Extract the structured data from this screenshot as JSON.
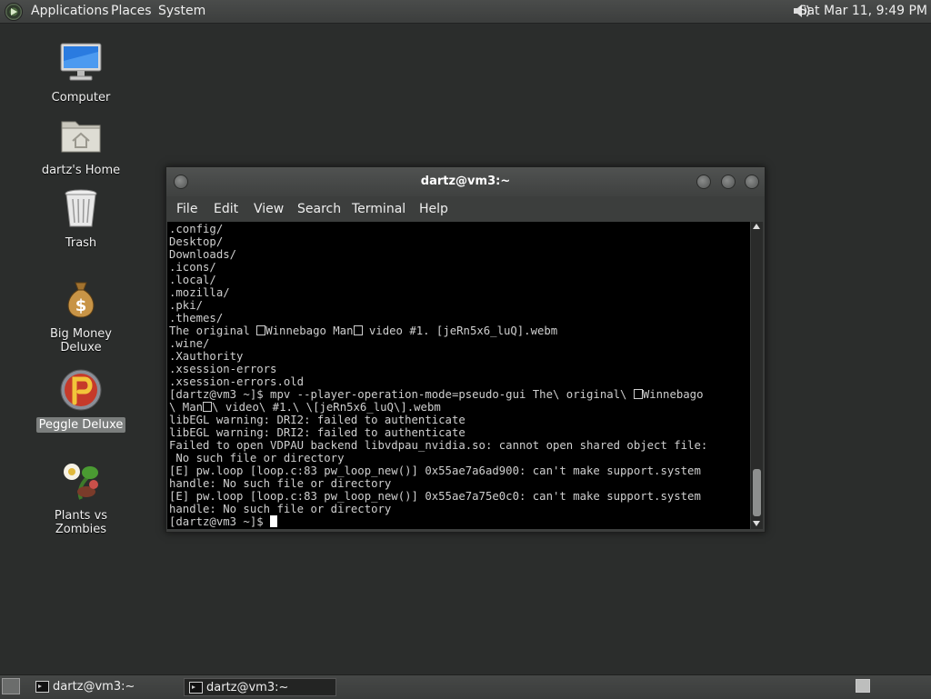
{
  "top_panel": {
    "menu": [
      "Applications",
      "Places",
      "System"
    ],
    "clock": "Sat Mar 11,  9:49 PM",
    "logo_icon": "distro-logo-icon",
    "volume_icon": "volume-icon"
  },
  "desktop_icons": [
    {
      "label": "Computer",
      "icon": "computer-icon"
    },
    {
      "label": "dartz's Home",
      "icon": "home-folder-icon"
    },
    {
      "label": "Trash",
      "icon": "trash-icon"
    },
    {
      "label": "Big Money Deluxe",
      "icon": "money-bag-icon"
    },
    {
      "label": "Peggle Deluxe",
      "icon": "peggle-icon",
      "selected": true
    },
    {
      "label": "Plants vs Zombies",
      "icon": "plant-icon"
    }
  ],
  "terminal": {
    "title": "dartz@vm3:~",
    "menu": [
      "File",
      "Edit",
      "View",
      "Search",
      "Terminal",
      "Help"
    ],
    "lines": [
      ".config/",
      "Desktop/",
      "Downloads/",
      ".icons/",
      ".local/",
      ".mozilla/",
      ".pki/",
      ".themes/",
      "The original □Winnebago Man□ video #1. [jeRn5x6_luQ].webm",
      ".wine/",
      ".Xauthority",
      ".xsession-errors",
      ".xsession-errors.old",
      "[dartz@vm3 ~]$ mpv --player-operation-mode=pseudo-gui The\\ original\\ □Winnebago",
      "\\ Man□\\ video\\ #1.\\ \\[jeRn5x6_luQ\\].webm",
      "libEGL warning: DRI2: failed to authenticate",
      "libEGL warning: DRI2: failed to authenticate",
      "Failed to open VDPAU backend libvdpau_nvidia.so: cannot open shared object file:",
      " No such file or directory",
      "[E] pw.loop [loop.c:83 pw_loop_new()] 0x55ae7a6ad900: can't make support.system",
      "handle: No such file or directory",
      "[E] pw.loop [loop.c:83 pw_loop_new()] 0x55ae7a75e0c0: can't make support.system",
      "handle: No such file or directory",
      "[dartz@vm3 ~]$ "
    ]
  },
  "taskbar": {
    "tasks": [
      {
        "label": "dartz@vm3:~",
        "active": false
      },
      {
        "label": "dartz@vm3:~",
        "active": true
      }
    ],
    "show_desktop_icon": "show-desktop-icon",
    "workspace_icon": "workspace-switcher-icon"
  },
  "colors": {
    "desktop_bg": "#2b2d2c",
    "terminal_bg": "#000000",
    "terminal_fg": "#cfcfcf"
  }
}
